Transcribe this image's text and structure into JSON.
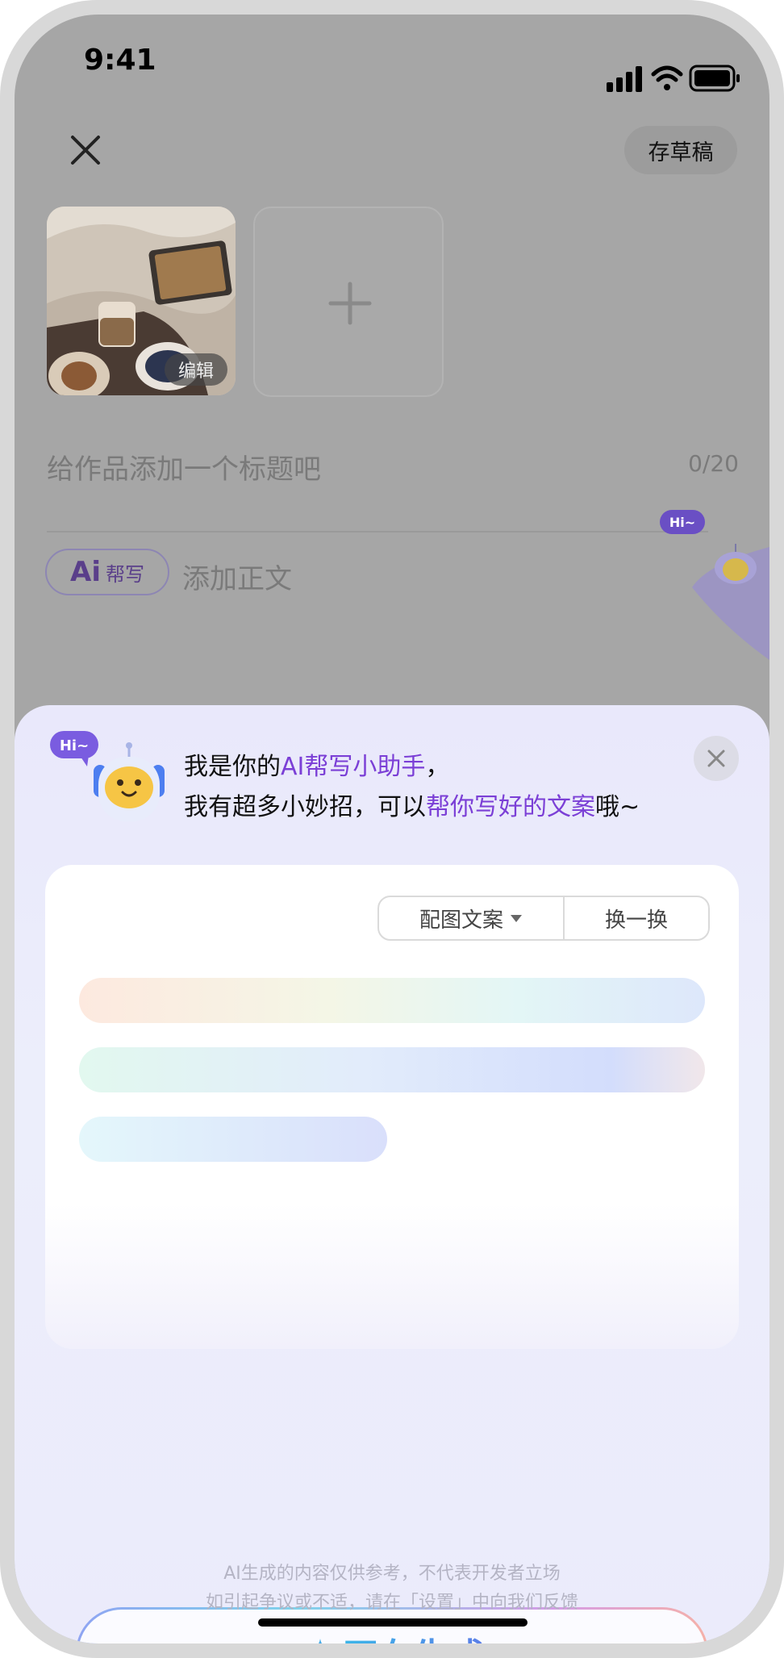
{
  "status_bar": {
    "time": "9:41"
  },
  "header": {
    "save_draft_label": "存草稿"
  },
  "media": {
    "edit_label": "编辑"
  },
  "title_field": {
    "placeholder": "给作品添加一个标题吧",
    "counter": "0/20"
  },
  "body_field": {
    "ai_label": "Ai",
    "ai_sub": "帮写",
    "placeholder": "添加正文"
  },
  "mascot": {
    "hi_label": "Hi~"
  },
  "assistant_sheet": {
    "intro_line1_prefix": "我是你的",
    "intro_line1_highlight": "AI帮写小助手",
    "intro_line1_suffix": "，",
    "intro_line2_prefix": "我有超多小妙招，可以",
    "intro_line2_highlight": "帮你写好的文案",
    "intro_line2_suffix": "哦~",
    "style_dropdown_label": "配图文案",
    "refresh_label": "换一换",
    "generate_button_label": "正在生成",
    "disclaimer_line1": "AI生成的内容仅供参考，不代表开发者立场",
    "disclaimer_line2": "如引起争议或不适，请在「设置」中向我们反馈"
  },
  "colors": {
    "accent_purple": "#7b3fd6",
    "generate_blue": "#3bb6e8",
    "overlay_gray": "#a6a6a6"
  }
}
